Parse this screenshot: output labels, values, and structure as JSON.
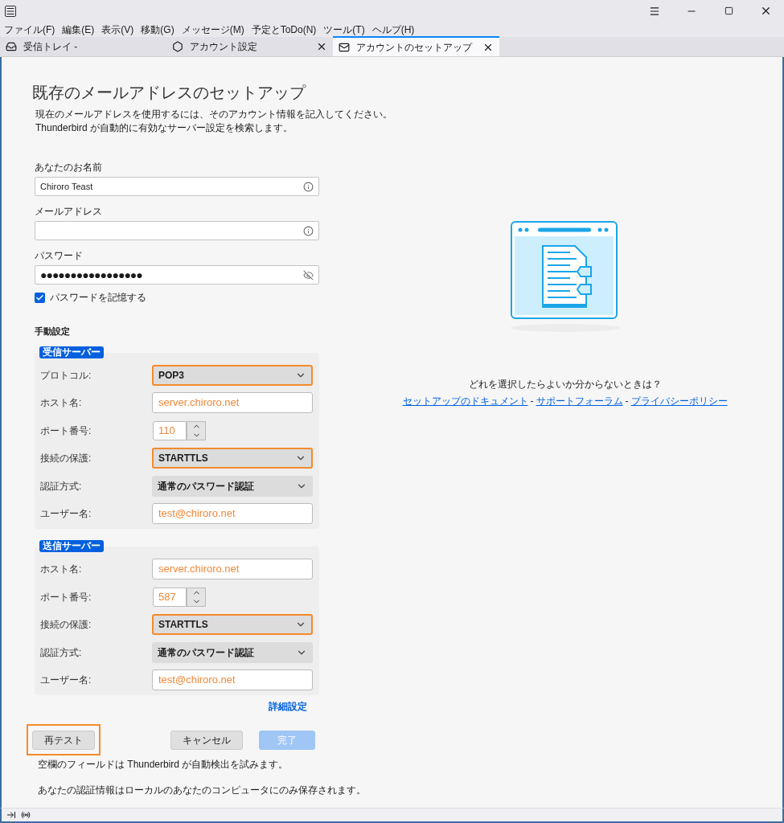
{
  "menu": [
    "ファイル(F)",
    "編集(E)",
    "表示(V)",
    "移動(G)",
    "メッセージ(M)",
    "予定とToDo(N)",
    "ツール(T)",
    "ヘルプ(H)"
  ],
  "tabs": [
    {
      "label": "受信トレイ -",
      "kind": "inbox",
      "selected": false,
      "closable": false
    },
    {
      "label": "アカウント設定",
      "kind": "settings",
      "selected": false,
      "closable": true
    },
    {
      "label": "アカウントのセットアップ",
      "kind": "setup",
      "selected": true,
      "closable": true
    }
  ],
  "page": {
    "title": "既存のメールアドレスのセットアップ",
    "description": [
      "現在のメールアドレスを使用するには、そのアカウント情報を記入してください。",
      "Thunderbird が自動的に有効なサーバー設定を検索します。"
    ]
  },
  "fields": [
    {
      "label": "あなたのお名前",
      "value": "Chiroro Teast",
      "kind": "text"
    },
    {
      "label": "メールアドレス",
      "kind": "text"
    },
    {
      "label": "パスワード",
      "value": "●●●●●●●●●●●●●●●●●",
      "kind": "password"
    }
  ],
  "remember_password": {
    "label": "パスワードを記憶する",
    "checked": true
  },
  "manual_settings": {
    "title": "手動設定",
    "servers": [
      {
        "badge": "受信サーバー",
        "rows": [
          {
            "label": "プロトコル:",
            "kind": "select",
            "value": "POP3",
            "highlighted": true
          },
          {
            "label": "ホスト名:",
            "kind": "text",
            "value": "server.chiroro.net",
            "highlighted": false
          },
          {
            "label": "ポート番号:",
            "kind": "number",
            "value": "110",
            "highlighted": false
          },
          {
            "label": "接続の保護:",
            "kind": "select",
            "value": "STARTTLS",
            "highlighted": true
          },
          {
            "label": "認証方式:",
            "kind": "select",
            "value": "通常のパスワード認証",
            "highlighted": false
          },
          {
            "label": "ユーザー名:",
            "kind": "text",
            "value": "test@chiroro.net",
            "highlighted": false
          }
        ]
      },
      {
        "badge": "送信サーバー",
        "rows": [
          {
            "label": "ホスト名:",
            "kind": "text",
            "value": "server.chiroro.net",
            "highlighted": false
          },
          {
            "label": "ポート番号:",
            "kind": "number",
            "value": "587",
            "highlighted": false
          },
          {
            "label": "接続の保護:",
            "kind": "select",
            "value": "STARTTLS",
            "highlighted": true
          },
          {
            "label": "認証方式:",
            "kind": "select",
            "value": "通常のパスワード認証",
            "highlighted": false
          },
          {
            "label": "ユーザー名:",
            "kind": "text",
            "value": "test@chiroro.net",
            "highlighted": false
          }
        ]
      }
    ]
  },
  "advanced_link": "詳細設定",
  "buttons": [
    {
      "label": "再テスト",
      "highlighted": true,
      "disabled": false
    },
    {
      "label": "キャンセル",
      "highlighted": false,
      "disabled": false
    },
    {
      "label": "完了",
      "highlighted": false,
      "disabled": true
    }
  ],
  "notes": [
    "空欄のフィールドは Thunderbird が自動検出を試みます。",
    "あなたの認証情報はローカルのあなたのコンピュータにのみ保存されます。"
  ],
  "help": {
    "question": "どれを選択したらよいか分からないときは？",
    "links": [
      "セットアップのドキュメント",
      "サポートフォーラム",
      "プライバシーポリシー"
    ],
    "separators": [
      "-",
      "-"
    ]
  }
}
